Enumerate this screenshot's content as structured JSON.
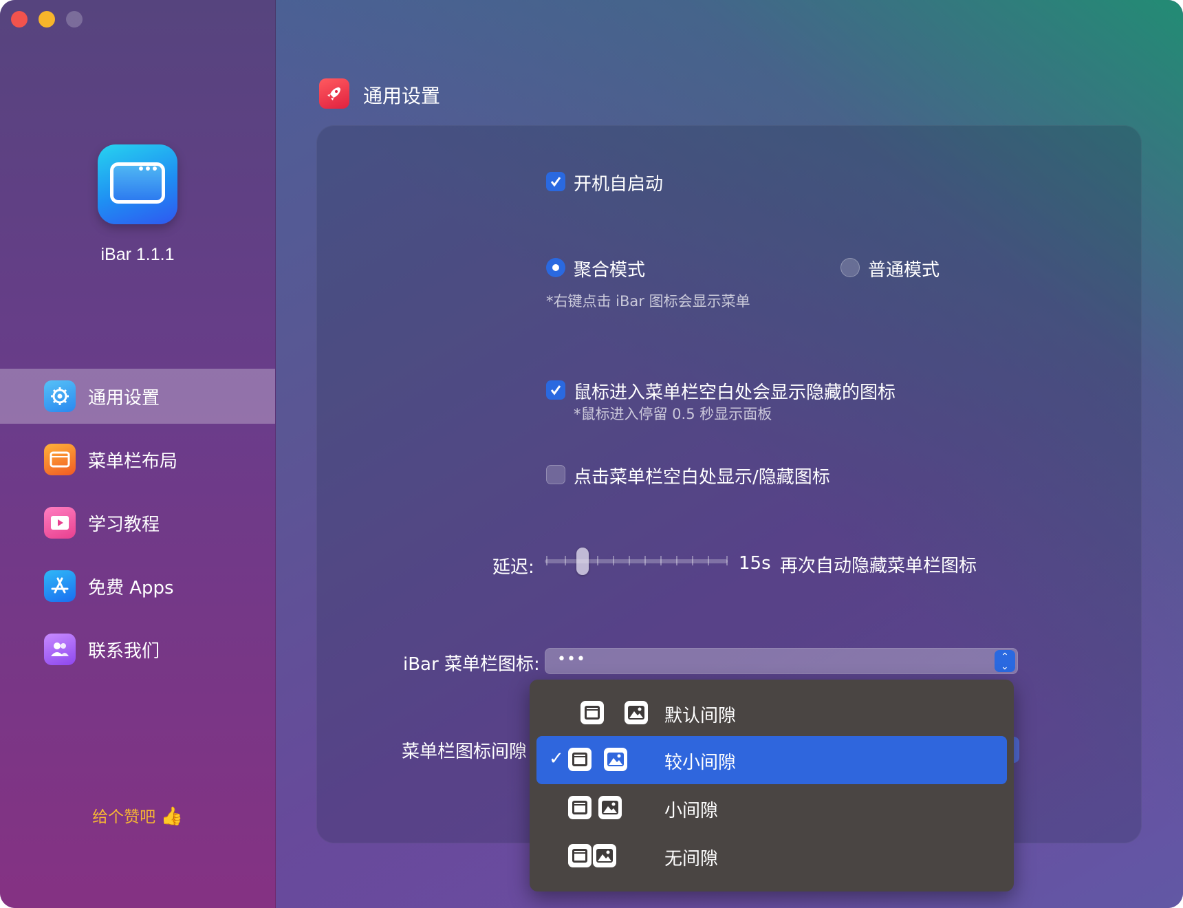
{
  "app": {
    "name": "iBar 1.1.1"
  },
  "sidebar": {
    "items": [
      {
        "label": "通用设置",
        "icon": "gear-icon",
        "color": "#3ba6f2",
        "active": true
      },
      {
        "label": "菜单栏布局",
        "icon": "menubar-window-icon",
        "color": "#f5782a",
        "active": false
      },
      {
        "label": "学习教程",
        "icon": "video-play-icon",
        "color": "#f35aa5",
        "active": false
      },
      {
        "label": "免费 Apps",
        "icon": "app-store-icon",
        "color": "#1f8cf2",
        "active": false
      },
      {
        "label": "联系我们",
        "icon": "contacts-icon",
        "color": "#a85bf2",
        "active": false
      }
    ],
    "like_label": "给个赞吧"
  },
  "header": {
    "title": "通用设置"
  },
  "settings": {
    "launch_at_login": {
      "label": "开机自启动",
      "checked": true
    },
    "mode": {
      "options": [
        {
          "label": "聚合模式",
          "selected": true
        },
        {
          "label": "普通模式",
          "selected": false
        }
      ],
      "note": "*右键点击 iBar 图标会显示菜单"
    },
    "hover_show": {
      "label": "鼠标进入菜单栏空白处会显示隐藏的图标",
      "note": "*鼠标进入停留 0.5 秒显示面板",
      "checked": true
    },
    "click_toggle": {
      "label": "点击菜单栏空白处显示/隐藏图标",
      "checked": false
    },
    "delay": {
      "label": "延迟:",
      "value_text": "15s",
      "suffix": "再次自动隐藏菜单栏图标",
      "value": 15
    },
    "menubar_icon": {
      "label": "iBar 菜单栏图标:",
      "value": "•••"
    },
    "icon_spacing": {
      "label": "菜单栏图标间隙",
      "options": [
        {
          "label": "默认间隙",
          "selected": false
        },
        {
          "label": "较小间隙",
          "selected": true
        },
        {
          "label": "小间隙",
          "selected": false
        },
        {
          "label": "无间隙",
          "selected": false
        }
      ],
      "checkmark": "✓"
    }
  },
  "colors": {
    "accent": "#2a69e0",
    "selection": "#2f66dd",
    "like": "#f7b733"
  }
}
